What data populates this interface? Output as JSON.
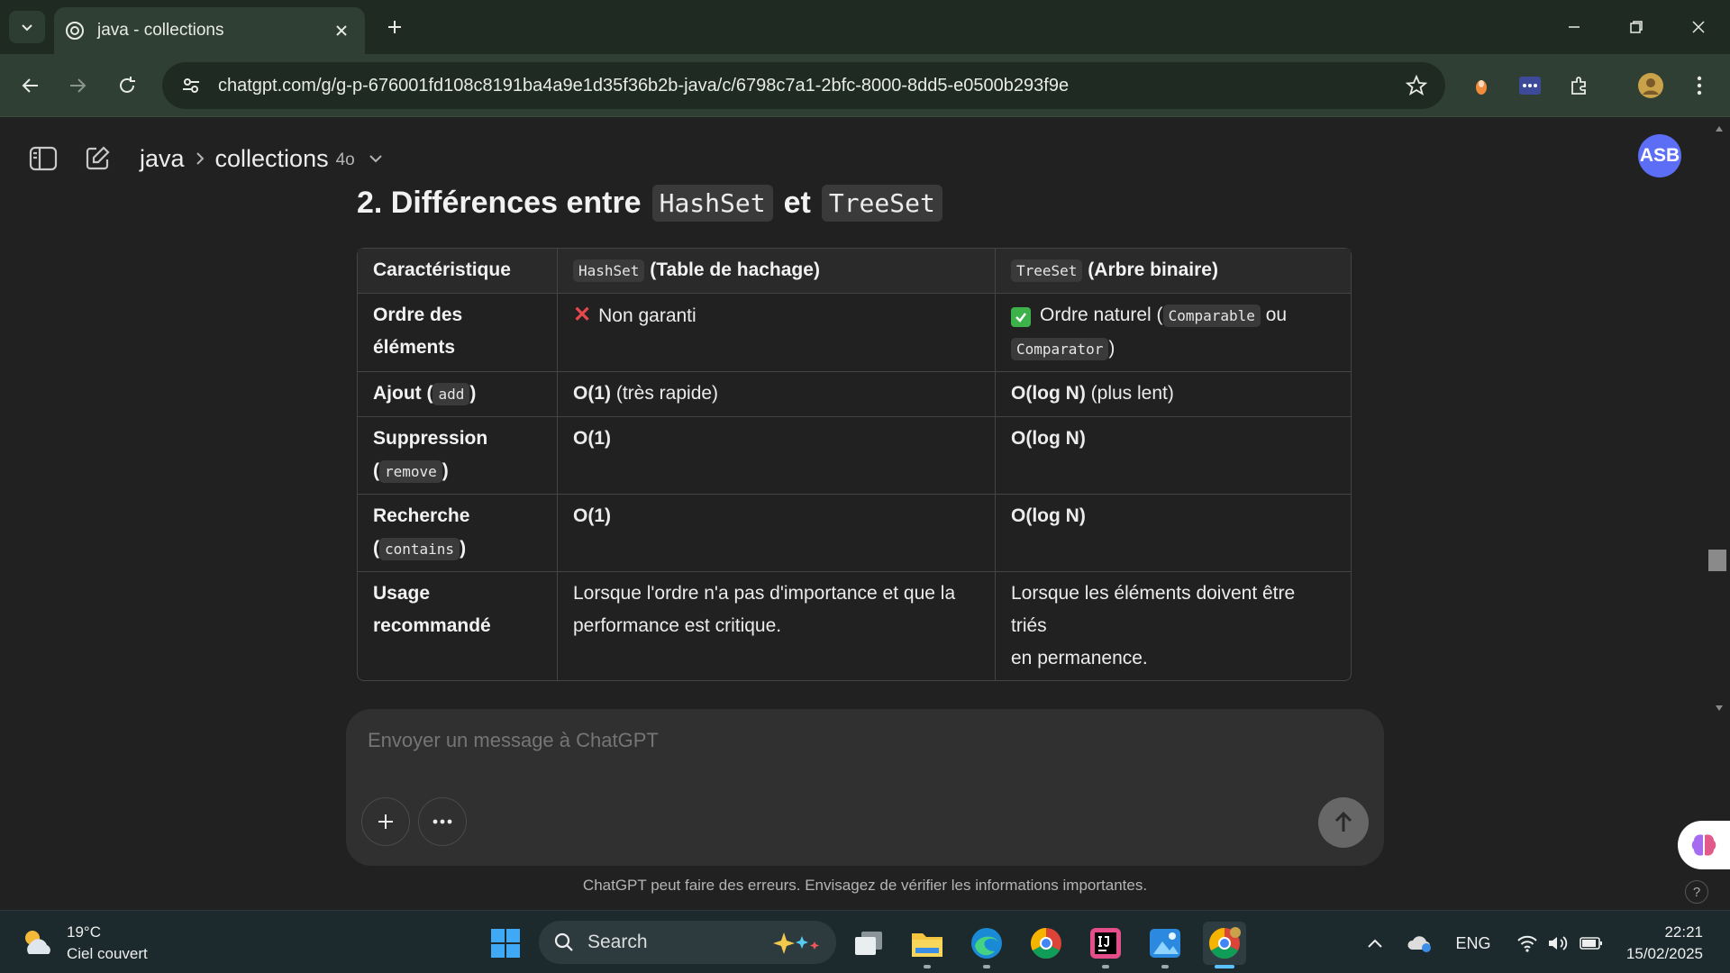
{
  "browser": {
    "tab_title": "java - collections",
    "url": "chatgpt.com/g/g-p-676001fd108c8191ba4a9e1d35f36b2b-java/c/6798c7a1-2bfc-8000-8dd5-e0500b293f9e"
  },
  "header": {
    "project": "java",
    "conversation": "collections",
    "model": "4o",
    "avatar_initials": "ASB"
  },
  "content": {
    "title_prefix": "2. Différences entre",
    "title_code1": "HashSet",
    "title_mid": "et",
    "title_code2": "TreeSet",
    "table": {
      "headers": {
        "col1": "Caractéristique",
        "col2_code": "HashSet",
        "col2_text": "(Table de hachage)",
        "col3_code": "TreeSet",
        "col3_text": "(Arbre binaire)"
      },
      "rows": [
        {
          "label_line1": "Ordre des",
          "label_line2": "éléments",
          "hashset": "Non garanti",
          "treeset_text": "Ordre naturel (",
          "treeset_code1": "Comparable",
          "treeset_mid": "ou",
          "treeset_code2": "Comparator",
          "treeset_end": ")"
        },
        {
          "label": "Ajout (",
          "label_code": "add",
          "label_end": ")",
          "hashset_bold": "O(1)",
          "hashset_text": "(très rapide)",
          "treeset_bold": "O(log N)",
          "treeset_text": "(plus lent)"
        },
        {
          "label": "Suppression",
          "label_open": "(",
          "label_code": "remove",
          "label_end": ")",
          "hashset_bold": "O(1)",
          "treeset_bold": "O(log N)"
        },
        {
          "label": "Recherche",
          "label_open": "(",
          "label_code": "contains",
          "label_end": ")",
          "hashset_bold": "O(1)",
          "treeset_bold": "O(log N)"
        },
        {
          "label_line1": "Usage",
          "label_line2": "recommandé",
          "hashset_line1": "Lorsque l'ordre n'a pas d'importance et que la",
          "hashset_line2": "performance est critique.",
          "treeset_line1": "Lorsque les éléments doivent être triés",
          "treeset_line2": "en permanence."
        }
      ]
    }
  },
  "composer": {
    "placeholder": "Envoyer un message à ChatGPT"
  },
  "disclaimer": "ChatGPT peut faire des erreurs. Envisagez de vérifier les informations importantes.",
  "help_label": "?",
  "taskbar": {
    "weather_temp": "19°C",
    "weather_desc": "Ciel couvert",
    "search_label": "Search",
    "language": "ENG",
    "time": "22:21",
    "date": "15/02/2025"
  },
  "colors": {
    "chrome_green": "#2f3f33",
    "page_bg": "#212121",
    "avatar_bg": "#5b6ef5",
    "cross_red": "#e5484d",
    "check_green": "#3db24b"
  }
}
